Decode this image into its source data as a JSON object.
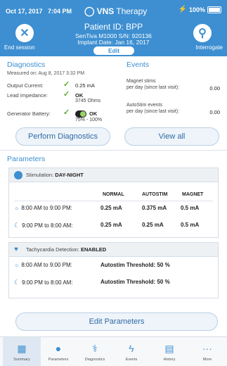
{
  "status_bar": {
    "date": "Oct 17, 2017",
    "time": "7:04 PM",
    "brand_bold": "VNS",
    "brand_light": "Therapy",
    "battery_pct": "100%",
    "battery_level": 1.0
  },
  "header": {
    "end_session_label": "End session",
    "interrogate_label": "Interrogate",
    "patient_id": "Patient ID: BPP",
    "device": "SenTiva M1000 S/N: 920136",
    "implant_date": "Implant Date: Jan 16, 2017",
    "edit_label": "Edit"
  },
  "diagnostics": {
    "title": "Diagnostics",
    "measured": "Measured on: Aug 8, 2017 3:32 PM",
    "output_current_label": "Output Current:",
    "output_current_value": "0.25 mA",
    "lead_impedance_label": "Lead Impedance:",
    "lead_impedance_value": "OK",
    "lead_impedance_ohms": "3745 Ohms",
    "generator_battery_label": "Generator Battery:",
    "generator_battery_value": "OK",
    "generator_battery_range": "75% - 100%",
    "perform_button": "Perform Diagnostics"
  },
  "events": {
    "title": "Events",
    "magnet_label_1": "Magnet stims",
    "magnet_label_2": "per day (since last visit):",
    "magnet_value": "0.00",
    "autostim_label_1": "AutoStim events",
    "autostim_label_2": "per day (since last visit):",
    "autostim_value": "0.00",
    "view_all_button": "View all"
  },
  "parameters": {
    "title": "Parameters",
    "stimulation": {
      "label": "Stimulation:",
      "value": "DAY-NIGHT",
      "columns": [
        "NORMAL",
        "AUTOSTIM",
        "MAGNET"
      ],
      "rows": [
        {
          "label": "8:00 AM to 9:00 PM:",
          "values": [
            "0.25 mA",
            "0.375 mA",
            "0.5 mA"
          ]
        },
        {
          "label": "9:00 PM to 8:00 AM:",
          "values": [
            "0.25 mA",
            "0.25 mA",
            "0.5 mA"
          ]
        }
      ]
    },
    "tachycardia": {
      "label": "Tachycardia Detection:",
      "value": "ENABLED",
      "rows": [
        {
          "label": "8:00 AM to 9:00 PM:",
          "value": "Autostim Threshold: 50 %"
        },
        {
          "label": "9:00 PM to 8:00 AM:",
          "value": "Autostim Threshold: 50 %"
        }
      ]
    },
    "edit_button": "Edit Parameters"
  },
  "tabs": [
    {
      "label": "Summary",
      "icon": "summary-icon"
    },
    {
      "label": "Parameters",
      "icon": "parameters-icon"
    },
    {
      "label": "Diagnostics",
      "icon": "diagnostics-icon"
    },
    {
      "label": "Events",
      "icon": "events-icon"
    },
    {
      "label": "History",
      "icon": "history-icon"
    },
    {
      "label": "More",
      "icon": "more-icon"
    }
  ],
  "colors": {
    "brand_blue": "#3d8fd1",
    "ok_green": "#5aa832"
  }
}
